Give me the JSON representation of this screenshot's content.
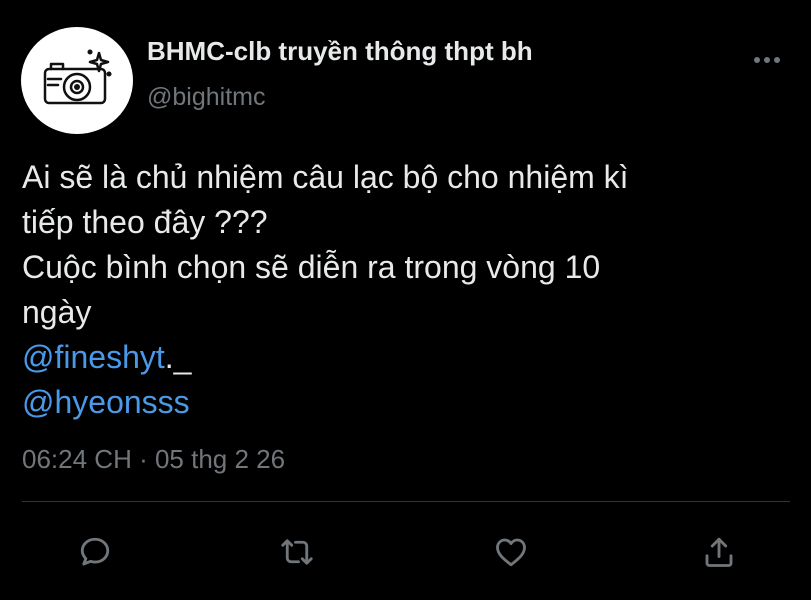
{
  "profile": {
    "display_name": "BHMC-clb truyền thông thpt bh",
    "handle": "@bighitmc",
    "avatar_icon": "camera-icon"
  },
  "tweet": {
    "lines": [
      "Ai sẽ là chủ nhiệm câu lạc bộ cho nhiệm kì",
      "tiếp theo đây ???",
      "Cuộc bình chọn sẽ diễn ra trong vòng 10",
      "ngày"
    ],
    "mentions": [
      {
        "handle": "@fineshyt",
        "tail": "._"
      },
      {
        "handle": "@hyeonsss",
        "tail": ""
      }
    ],
    "timestamp": "06:24 CH · 05 thg 2 26"
  },
  "actions": [
    {
      "name": "reply",
      "icon": "comment-icon"
    },
    {
      "name": "retweet",
      "icon": "retweet-icon"
    },
    {
      "name": "like",
      "icon": "heart-icon"
    },
    {
      "name": "share",
      "icon": "share-icon"
    }
  ],
  "colors": {
    "background": "#000000",
    "text": "#e7e9ea",
    "secondary": "#71767b",
    "link": "#4a99e9"
  }
}
